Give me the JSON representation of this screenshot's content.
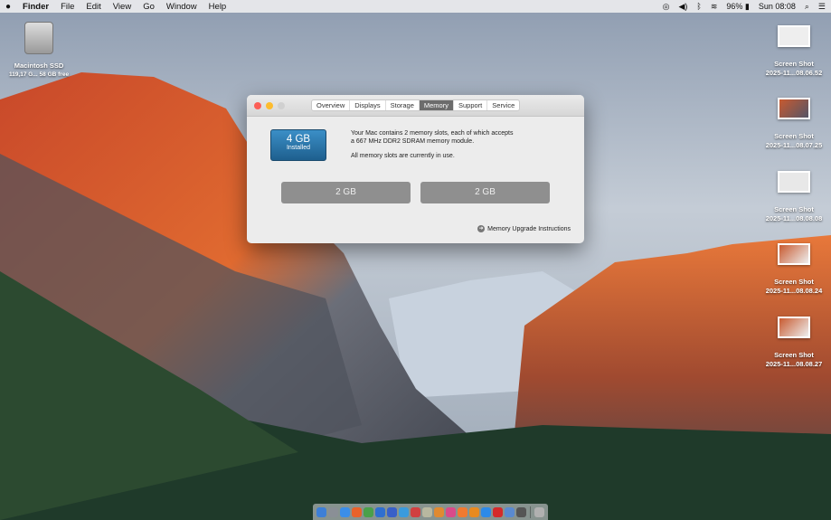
{
  "menubar": {
    "apple": "",
    "items": [
      "Finder",
      "File",
      "Edit",
      "View",
      "Go",
      "Window",
      "Help"
    ],
    "battery": "96%",
    "clock": "Sun 08:08"
  },
  "desktop": {
    "drive": {
      "name": "Macintosh SSD",
      "info": "119,17 G... 58 GB free"
    },
    "screenshots": [
      {
        "name": "Screen Shot",
        "date": "2025-11...08.06.52"
      },
      {
        "name": "Screen Shot",
        "date": "2025-11...08.07.25"
      },
      {
        "name": "Screen Shot",
        "date": "2025-11...08.08.08"
      },
      {
        "name": "Screen Shot",
        "date": "2025-11...08.08.24"
      },
      {
        "name": "Screen Shot",
        "date": "2025-11...08.08.27"
      }
    ]
  },
  "window": {
    "tabs": [
      "Overview",
      "Displays",
      "Storage",
      "Memory",
      "Support",
      "Service"
    ],
    "active_tab": "Memory",
    "installed": {
      "amount": "4 GB",
      "label": "Installed"
    },
    "line1": "Your Mac contains 2 memory slots, each of which accepts",
    "line2": "a 667 MHz DDR2 SDRAM memory module.",
    "line3": "All memory slots are currently in use.",
    "slots": [
      "2 GB",
      "2 GB"
    ],
    "upgrade_link": "Memory Upgrade Instructions"
  },
  "dock": {
    "colors": [
      "#3d7fd6",
      "#8a8f96",
      "#3b8ee8",
      "#e8622a",
      "#4aa04a",
      "#2f6fd0",
      "#3860c8",
      "#3a9bdc",
      "#d04040",
      "#b8b8a0",
      "#e08a30",
      "#d94a8a",
      "#f07a30",
      "#e88a20",
      "#2d8ae8",
      "#d42a2a",
      "#5a8ad0",
      "#555555",
      "#b0b0b0"
    ]
  }
}
